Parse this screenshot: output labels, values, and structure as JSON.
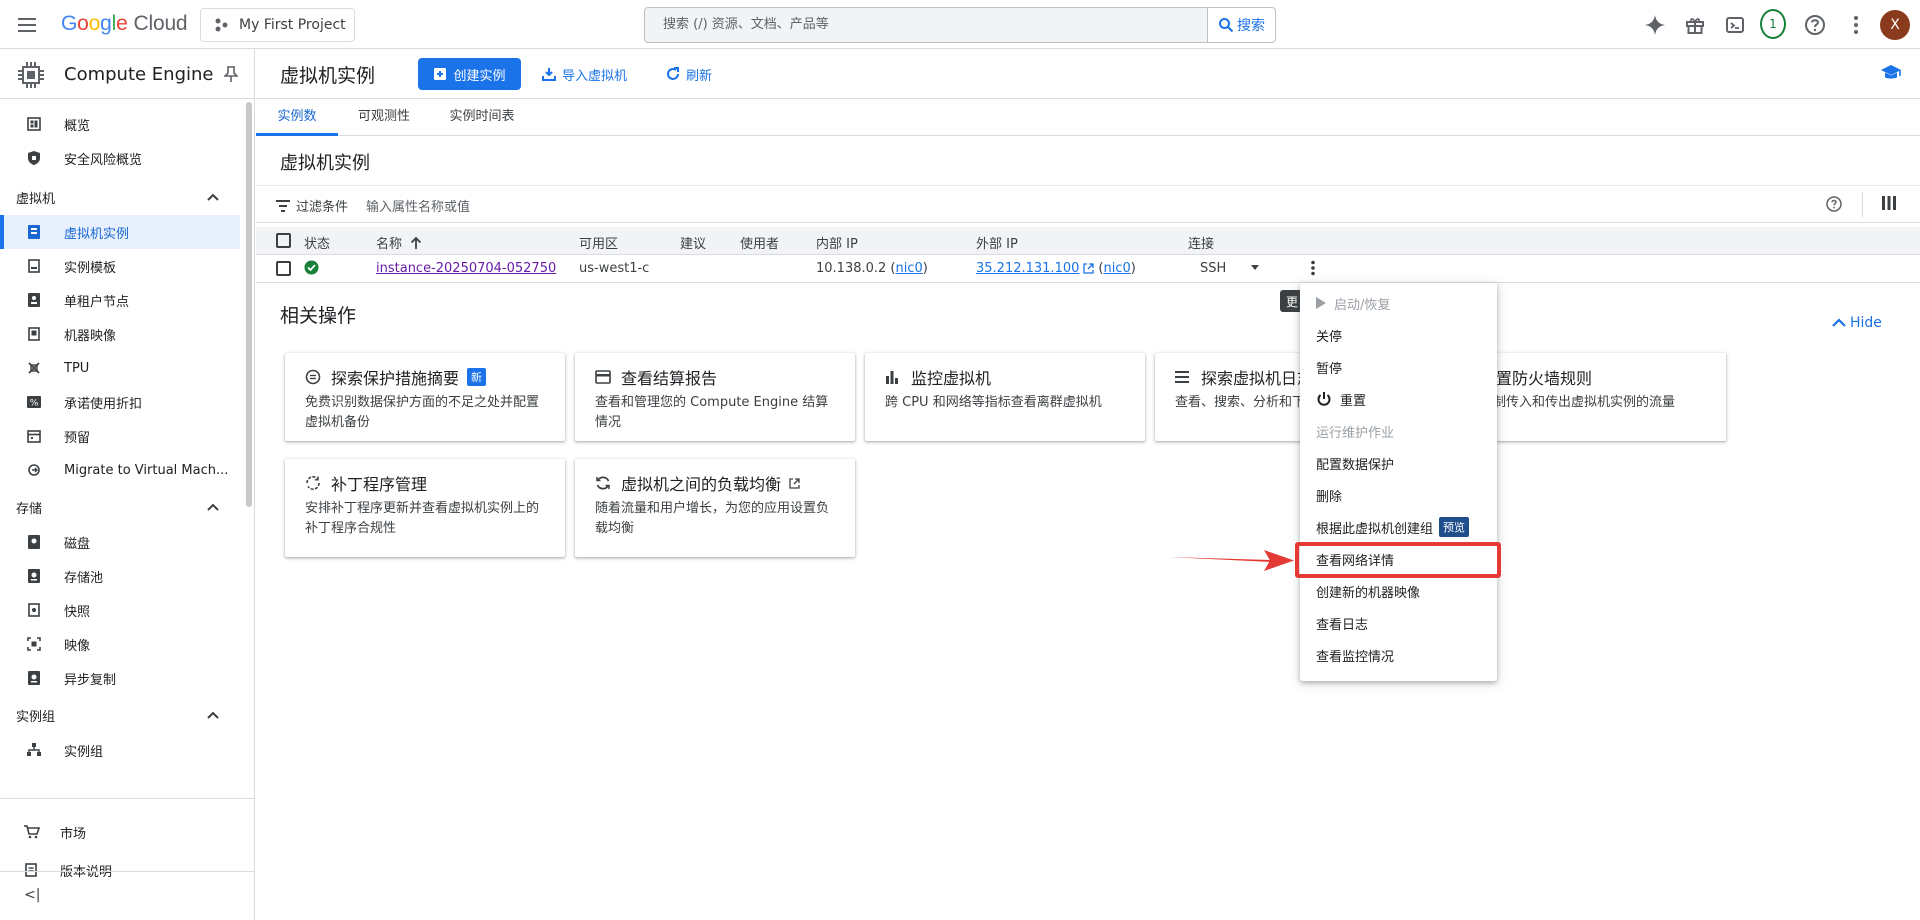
{
  "topbar": {
    "logo_parts": [
      "G",
      "o",
      "o",
      "g",
      "l",
      "e"
    ],
    "logo_suffix": "Cloud",
    "project": "My First Project",
    "search_placeholder": "搜索 (/) 资源、文档、产品等",
    "search_button": "搜索",
    "notification_count": "1",
    "avatar_letter": "X"
  },
  "sidebar": {
    "product": "Compute Engine",
    "items_top": [
      "概览",
      "安全风险概览"
    ],
    "section_vm": "虚拟机",
    "vm_items": [
      "虚拟机实例",
      "实例模板",
      "单租户节点",
      "机器映像",
      "TPU",
      "承诺使用折扣",
      "预留",
      "Migrate to Virtual Mach..."
    ],
    "section_storage": "存储",
    "storage_items": [
      "磁盘",
      "存储池",
      "快照",
      "映像",
      "异步复制"
    ],
    "section_groups": "实例组",
    "group_items": [
      "实例组"
    ],
    "bottom_items": [
      "市场",
      "版本说明"
    ],
    "collapse": "<|"
  },
  "page": {
    "title": "虚拟机实例",
    "create_button": "创建实例",
    "import_button": "导入虚拟机",
    "refresh_button": "刷新",
    "tabs": [
      "实例数",
      "可观测性",
      "实例时间表"
    ],
    "section_title": "虚拟机实例",
    "filter_label": "过滤条件",
    "filter_placeholder": "输入属性名称或值"
  },
  "table": {
    "headers": [
      "状态",
      "名称",
      "可用区",
      "建议",
      "使用者",
      "内部 IP",
      "外部 IP",
      "连接"
    ],
    "row": {
      "name": "instance-20250704-052750",
      "zone": "us-west1-c",
      "internal_ip": "10.138.0.2",
      "internal_nic": "nic0",
      "external_ip": "35.212.131.100",
      "external_nic": "nic0",
      "connect": "SSH"
    }
  },
  "related": {
    "title": "相关操作",
    "hide": "Hide",
    "cards": [
      {
        "title": "探索保护措施摘要",
        "chip": "新",
        "desc": "免费识别数据保护方面的不足之处并配置虚拟机备份"
      },
      {
        "title": "查看结算报告",
        "desc": "查看和管理您的 Compute Engine 结算情况"
      },
      {
        "title": "监控虚拟机",
        "desc": "跨 CPU 和网络等指标查看离群虚拟机"
      },
      {
        "title": "探索虚拟机日志",
        "desc": "查看、搜索、分析和下载虚拟机实例日志"
      },
      {
        "title": "设置防火墙规则",
        "desc": "控制传入和传出虚拟机实例的流量"
      },
      {
        "title": "补丁程序管理",
        "desc": "安排补丁程序更新并查看虚拟机实例上的补丁程序合规性"
      },
      {
        "title": "虚拟机之间的负载均衡",
        "desc": "随着流量和用户增长，为您的应用设置负载均衡"
      }
    ]
  },
  "tooltip_text": "更",
  "menu": {
    "items": [
      "启动/恢复",
      "关停",
      "暂停",
      "重置",
      "运行维护作业",
      "配置数据保护",
      "删除",
      "根据此虚拟机创建组",
      "查看网络详情",
      "创建新的机器映像",
      "查看日志",
      "查看监控情况"
    ],
    "preview_chip": "预览"
  }
}
